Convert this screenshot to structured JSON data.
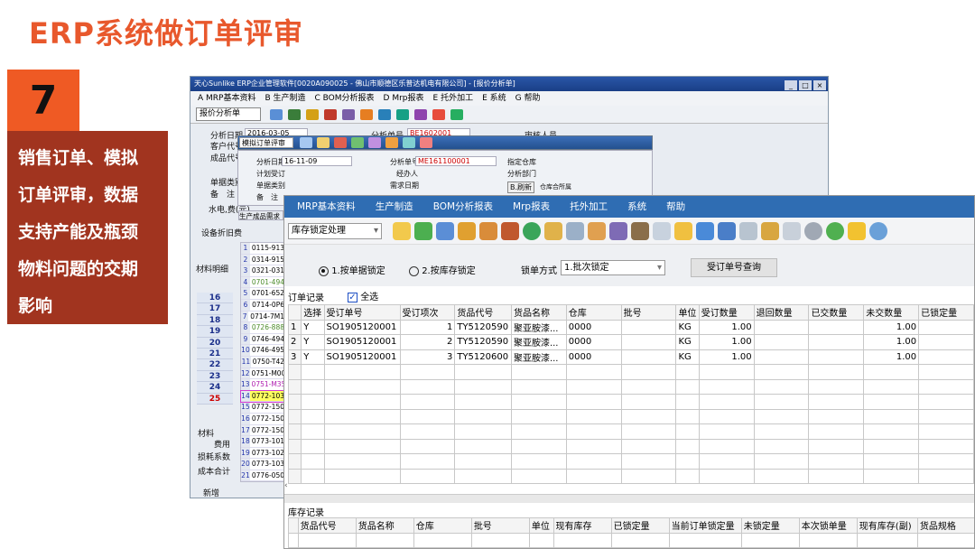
{
  "slide": {
    "title": "ERP系统做订单评审",
    "number": "7",
    "caption_lines": [
      "销售订单、模拟",
      "订单评审，数据",
      "支持产能及瓶颈",
      "物料问题的交期",
      "影响"
    ]
  },
  "win1": {
    "title": "天心Sunlike ERP企业管理软件[0020A090025 - 佛山市顺德区乐普达机电有限公司] - [报价分析单]",
    "menu": [
      "A MRP基本资料",
      "B 生产制造",
      "C BOM分析报表",
      "D Mrp报表",
      "E 托外加工",
      "E 系统",
      "G 帮助"
    ],
    "select": "报价分析单",
    "labels": [
      "分析日期",
      "客户代号",
      "成品代号",
      "单据类别",
      "备　注",
      "水电,费(元)",
      "设备折旧费",
      "材料明细",
      "费用",
      "损耗系数",
      "成本合计",
      "新增"
    ],
    "analysis_date": "2016-03-05",
    "analysis_no": "BE1602001",
    "analysis_no_label": "分析单号",
    "approver_label": "审核人员",
    "row_numbers": [
      "16",
      "17",
      "18",
      "19",
      "20",
      "21",
      "22",
      "23",
      "24",
      "25"
    ],
    "tabs": [
      "材料明细",
      "材料"
    ]
  },
  "win2": {
    "select": "模拟订单评审",
    "date_label": "分析日期",
    "date": "16-11-09",
    "no_label": "分析单号",
    "no": "ME161100001",
    "warehouse_label": "指定仓库",
    "agent_label": "经办人",
    "plan_label": "计划受订",
    "req_date_label": "需求日期",
    "dept_label": "分析部门",
    "doc_label": "单据类别",
    "note_label": "备　注",
    "refresh": "B.刷新",
    "all_wh": "仓库合所属",
    "tab": "生产成品需求",
    "rows": [
      {
        "n": "1",
        "c": "0115-913"
      },
      {
        "n": "2",
        "c": "0314-915"
      },
      {
        "n": "3",
        "c": "0321-031"
      },
      {
        "n": "4",
        "c": "0701-494"
      },
      {
        "n": "5",
        "c": "0701-652"
      },
      {
        "n": "6",
        "c": "0714-0P6"
      },
      {
        "n": "7",
        "c": "0714-7M1"
      },
      {
        "n": "8",
        "c": "0726-888"
      },
      {
        "n": "9",
        "c": "0746-494"
      },
      {
        "n": "10",
        "c": "0746-495"
      },
      {
        "n": "11",
        "c": "0750-T42"
      },
      {
        "n": "12",
        "c": "0751-M00"
      },
      {
        "n": "13",
        "c": "0751-M35"
      },
      {
        "n": "14",
        "c": "0772-103"
      },
      {
        "n": "15",
        "c": "0772-150"
      },
      {
        "n": "16",
        "c": "0772-150"
      },
      {
        "n": "17",
        "c": "0772-150"
      },
      {
        "n": "18",
        "c": "0773-101"
      },
      {
        "n": "19",
        "c": "0773-102"
      },
      {
        "n": "20",
        "c": "0773-103"
      },
      {
        "n": "21",
        "c": "0776-050"
      }
    ]
  },
  "win3": {
    "menu": [
      "MRP基本资料",
      "生产制造",
      "BOM分析报表",
      "Mrp报表",
      "托外加工",
      "系统",
      "帮助"
    ],
    "select": "库存锁定处理",
    "opt1": "1.按单据锁定",
    "opt2": "2.按库存锁定",
    "lock_label": "锁单方式",
    "lock_value": "1.批次锁定",
    "query": "受订单号查询",
    "order_title": "订单记录",
    "select_all": "全选",
    "order_headers": [
      "",
      "选择",
      "受订单号",
      "受订项次",
      "货品代号",
      "货品名称",
      "仓库",
      "批号",
      "单位",
      "受订数量",
      "退回数量",
      "已交数量",
      "未交数量",
      "已锁定量"
    ],
    "order_rows": [
      [
        "1",
        "Y",
        "SO1905120001",
        "1",
        "TY5120590",
        "聚亚胺漆...",
        "0000",
        "",
        "KG",
        "1.00",
        "",
        "",
        "1.00",
        ""
      ],
      [
        "2",
        "Y",
        "SO1905120001",
        "2",
        "TY5120590",
        "聚亚胺漆...",
        "0000",
        "",
        "KG",
        "1.00",
        "",
        "",
        "1.00",
        ""
      ],
      [
        "3",
        "Y",
        "SO1905120001",
        "3",
        "TY5120600",
        "聚亚胺漆...",
        "0000",
        "",
        "KG",
        "1.00",
        "",
        "",
        "1.00",
        ""
      ]
    ],
    "stock_title": "库存记录",
    "stock_headers": [
      "",
      "货品代号",
      "货品名称",
      "仓库",
      "批号",
      "单位",
      "现有库存",
      "已锁定量",
      "当前订单锁定量",
      "未锁定量",
      "本次锁单量",
      "现有库存(副)",
      "货品规格"
    ]
  }
}
